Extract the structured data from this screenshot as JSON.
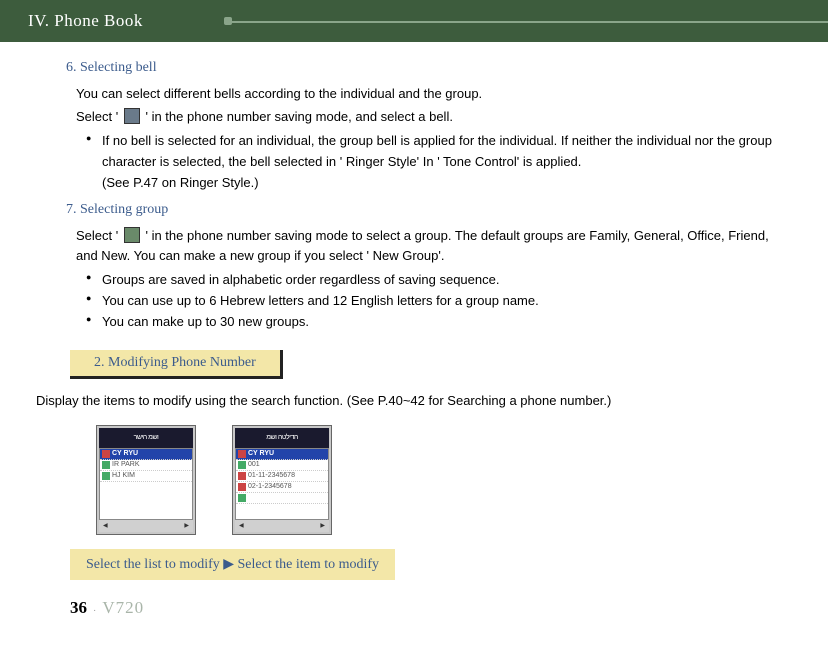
{
  "header": {
    "title": "IV. Phone Book"
  },
  "section6": {
    "title": "6. Selecting bell",
    "intro": "You can select different bells according to the individual and the group.",
    "select_pre": "Select '",
    "select_post": "' in the phone number saving mode, and select a bell.",
    "bullet1": "If no bell is selected for an individual, the group bell is applied for the individual. If neither the individual nor the group character is selected, the bell selected in ' Ringer Style' In ' Tone Control' is applied.",
    "bullet_note": "(See P.47 on Ringer Style.)"
  },
  "section7": {
    "title": "7. Selecting group",
    "para_pre": "Select    '",
    "para_post": "' in the phone number saving mode to select a group. The default groups are Family, General, Office, Friend, and New. You can make a new group if you select ' New Group'.",
    "bullet1": "Groups are saved in alphabetic order regardless of saving sequence.",
    "bullet2": "You can use up to 6 Hebrew letters and 12 English letters for a group name.",
    "bullet3": "You can make up to 30 new groups."
  },
  "section2box": {
    "title": "2. Modifying Phone Number"
  },
  "modify": {
    "intro": "Display the items to modify using the search function. (See P.40~42 for Searching a phone number.)",
    "instruction": "Select the list to modify ▶ Select the item to modify"
  },
  "phone1": {
    "title": "ושמ הישר",
    "row1": "CY RYU",
    "row2": "IR PARK",
    "row3": "HJ KIM"
  },
  "phone2": {
    "title": "הדילטה ושמ",
    "row1": "CY RYU",
    "row2": "001",
    "row3": "01-11-2345678",
    "row4": "02-1-2345678"
  },
  "footer": {
    "page": "36",
    "model": "V720"
  }
}
